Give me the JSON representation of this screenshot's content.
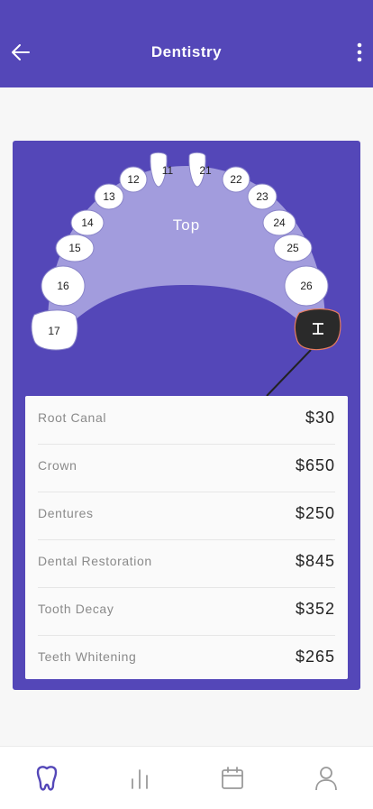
{
  "header": {
    "title": "Dentistry",
    "back_icon": "arrow-left-icon",
    "more_icon": "more-vertical-icon"
  },
  "teeth_chart": {
    "arch_label": "Top",
    "left_teeth": [
      "11",
      "12",
      "13",
      "14",
      "15",
      "16",
      "17"
    ],
    "right_teeth": [
      "21",
      "22",
      "23",
      "24",
      "25",
      "26"
    ],
    "selected_tooth_icon": "cursor-i-beam-icon",
    "colors": {
      "card": "#5447b8",
      "arch": "#a29cdd",
      "selected": "#2a2a2a",
      "accent": "#e67b5e"
    }
  },
  "treatments": [
    {
      "name": "Root Canal",
      "price": "$30"
    },
    {
      "name": "Crown",
      "price": "$650"
    },
    {
      "name": "Dentures",
      "price": "$250"
    },
    {
      "name": "Dental Restoration",
      "price": "$845"
    },
    {
      "name": "Tooth Decay",
      "price": "$352"
    },
    {
      "name": "Teeth Whitening",
      "price": "$265"
    }
  ],
  "tabs": [
    {
      "icon": "tooth-icon",
      "active": true
    },
    {
      "icon": "bar-chart-icon",
      "active": false
    },
    {
      "icon": "calendar-icon",
      "active": false
    },
    {
      "icon": "profile-icon",
      "active": false
    }
  ]
}
